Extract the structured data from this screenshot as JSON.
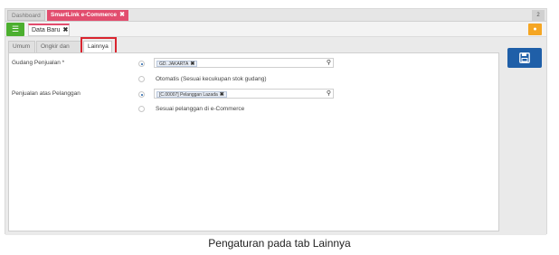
{
  "topbar": {
    "tabs": [
      {
        "label": "Dashboard"
      },
      {
        "label": "SmartLink e-Commerce",
        "close": "✖"
      }
    ],
    "zoom": "2"
  },
  "subbar": {
    "document_tab": {
      "label": "Data Baru",
      "close": "✖"
    }
  },
  "form_tabs": [
    {
      "label": "Umum"
    },
    {
      "label": "Ongkir dan Fee"
    },
    {
      "label": "Lainnya"
    }
  ],
  "form": {
    "gudang_penjualan": {
      "label": "Gudang Penjualan",
      "required_mark": "*",
      "selected_chip": "GD. JAKARTA",
      "alt_option": "Otomatis (Sesuai kecukupan stok gudang)"
    },
    "penjualan_atas_pelanggan": {
      "label": "Penjualan atas Pelanggan",
      "selected_chip": "[C.00007] Pelanggan Lazada",
      "alt_option": "Sesuai pelanggan di e-Commerce"
    }
  },
  "caption": "Pengaturan pada tab Lainnya",
  "colors": {
    "accent_pink": "#e24d6e",
    "save_blue": "#1f5fa8",
    "list_green": "#4caf2f",
    "highlight_red": "#d9252f"
  },
  "icons": [
    "list-icon",
    "close-icon",
    "search-icon",
    "save-icon",
    "lightbulb-icon"
  ]
}
